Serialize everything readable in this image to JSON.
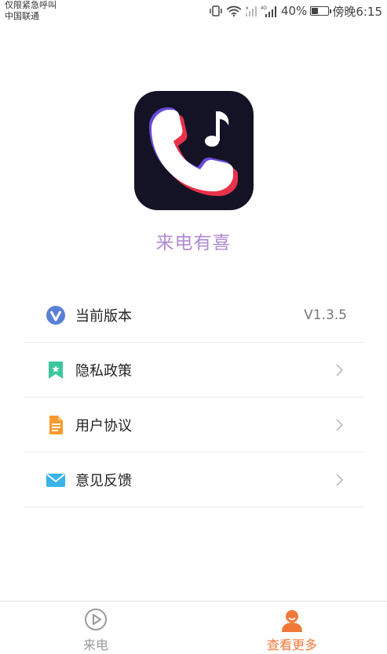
{
  "status_bar": {
    "carrier_line1": "仅限紧急呼叫",
    "carrier_line2": "中国联通",
    "network_label": "4G",
    "battery": "40%",
    "battery_level": 0.4,
    "time": "傍晚6:15"
  },
  "app": {
    "name": "来电有喜"
  },
  "menu": {
    "items": [
      {
        "label": "当前版本",
        "value": "V1.3.5",
        "icon": "version-v-icon"
      },
      {
        "label": "隐私政策",
        "icon": "privacy-bookmark-icon"
      },
      {
        "label": "用户协议",
        "icon": "document-icon"
      },
      {
        "label": "意见反馈",
        "icon": "mail-icon"
      }
    ]
  },
  "tabbar": {
    "tabs": [
      {
        "label": "来电",
        "icon": "play-circle-icon"
      },
      {
        "label": "查看更多",
        "icon": "person-icon"
      }
    ]
  },
  "colors": {
    "accent": "#f0793a",
    "app_name": "#b189d2",
    "tab_inactive": "#9a9a9a"
  }
}
